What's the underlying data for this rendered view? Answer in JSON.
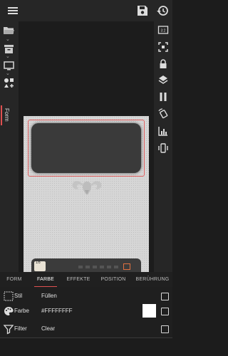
{
  "toolbar": {
    "menu_icon": "menu-icon",
    "save_icon": "save-icon",
    "history_icon": "history-icon"
  },
  "left_tools": {
    "items": [
      "folder-open-icon",
      "archive-icon",
      "monitor-icon",
      "shapes-icon"
    ],
    "form_label": "Form"
  },
  "right_tools": {
    "items": [
      "aspect-ratio-icon",
      "fit-screen-icon",
      "lock-icon",
      "layers-icon",
      "pause-icon",
      "rotate-icon",
      "chart-icon",
      "vibrate-icon"
    ]
  },
  "canvas": {
    "bottom_number": "16",
    "background": "#d6d6d6",
    "selection_color": "#e06060"
  },
  "panel": {
    "tabs": [
      {
        "label": "FORM",
        "active": false
      },
      {
        "label": "FARBE",
        "active": true
      },
      {
        "label": "EFFEKTE",
        "active": false
      },
      {
        "label": "POSITION",
        "active": false
      },
      {
        "label": "BERÜHRUNG",
        "active": false
      }
    ],
    "rows": [
      {
        "label": "Stil",
        "value": "Füllen",
        "icon": "dotted-square-icon"
      },
      {
        "label": "Farbe",
        "value": "#FFFFFFFF",
        "icon": "palette-icon",
        "swatch": "#FFFFFF"
      },
      {
        "label": "Filter",
        "value": "Clear",
        "icon": "filter-icon"
      }
    ]
  },
  "colors": {
    "accent": "#e05050",
    "background": "#1c1c1c",
    "bar": "#262626"
  }
}
